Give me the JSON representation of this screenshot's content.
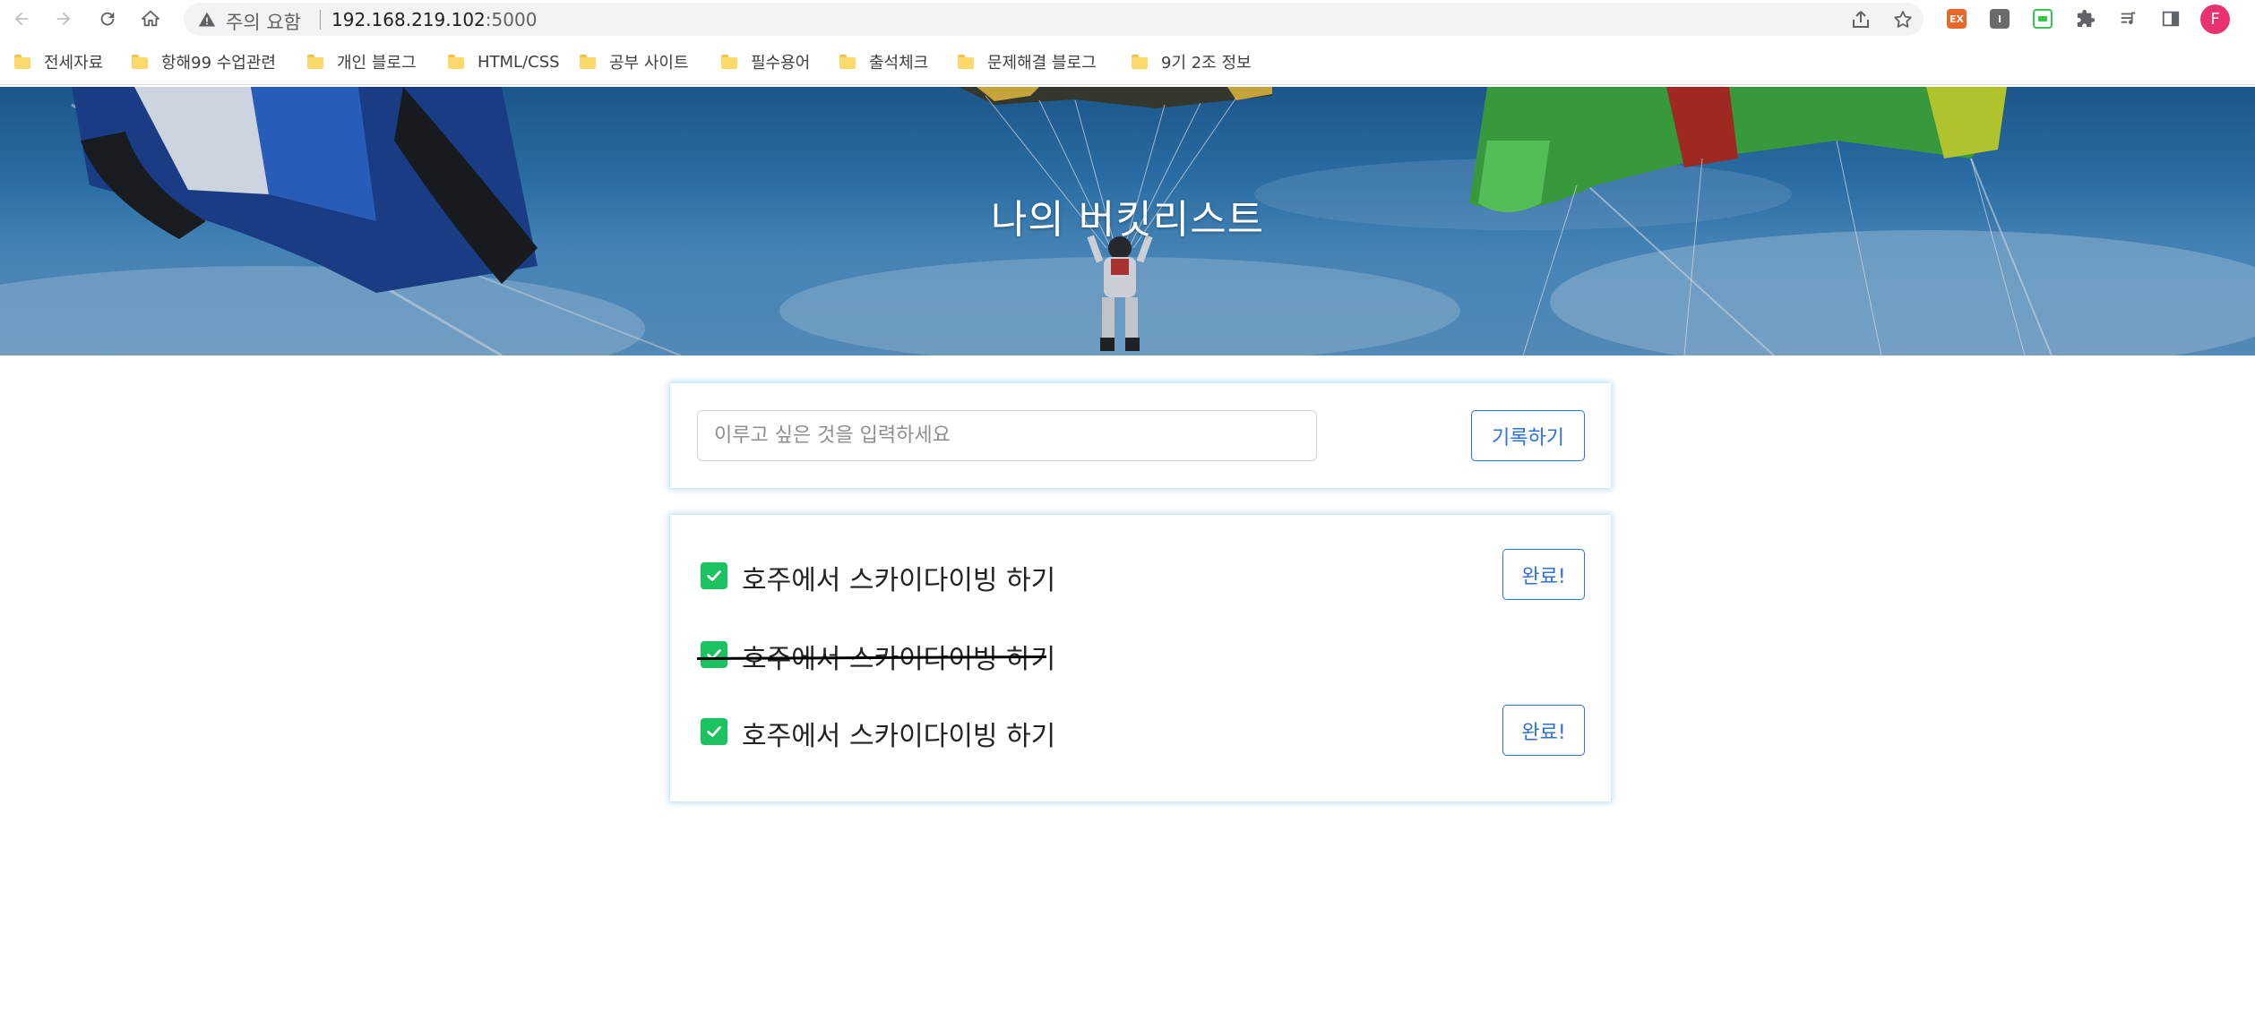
{
  "browser": {
    "warning_text": "주의 요함",
    "url_host": "192.168.219.102",
    "url_port": ":5000",
    "profile_initial": "F",
    "extensions": [
      {
        "name": "ex-extension",
        "label": "EX",
        "color": "#e8682c"
      },
      {
        "name": "i-extension",
        "label": "I",
        "color": "#6b6b6b"
      },
      {
        "name": "green-extension",
        "label": "",
        "color": "#35c64b"
      }
    ]
  },
  "bookmarks": [
    {
      "label": "전세자료"
    },
    {
      "label": "항해99 수업관련"
    },
    {
      "label": "개인 블로그"
    },
    {
      "label": "HTML/CSS"
    },
    {
      "label": "공부 사이트"
    },
    {
      "label": "필수용어"
    },
    {
      "label": "출석체크"
    },
    {
      "label": "문제해결 블로그"
    },
    {
      "label": "9기 2조 정보"
    }
  ],
  "page": {
    "title": "나의 버킷리스트",
    "input_placeholder": "이루고 싶은 것을 입력하세요",
    "input_value": "",
    "save_label": "기록하기",
    "accent_color": "#2f6fd9",
    "check_color": "#1bc25f"
  },
  "bucket_list": [
    {
      "text": "호주에서 스카이다이빙 하기",
      "done": false,
      "button_label": "완료!"
    },
    {
      "text": "호주에서 스카이다이빙 하기",
      "done": true
    },
    {
      "text": "호주에서 스카이다이빙 하기",
      "done": false,
      "button_label": "완료!"
    }
  ]
}
